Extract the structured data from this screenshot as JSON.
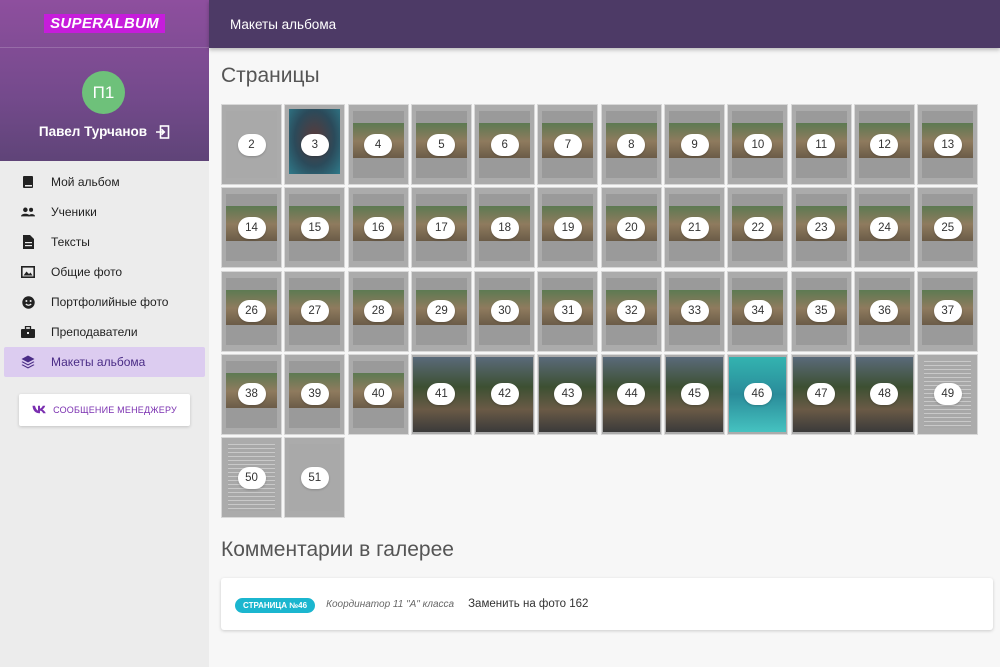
{
  "app": {
    "logo": "SUPERALBUM"
  },
  "user": {
    "avatar_initials": "П1",
    "name": "Павел Турчанов",
    "avatar_color": "#6ec17a"
  },
  "menu": [
    {
      "label": "Мой альбом",
      "icon": "book-icon"
    },
    {
      "label": "Ученики",
      "icon": "people-icon"
    },
    {
      "label": "Тексты",
      "icon": "document-icon"
    },
    {
      "label": "Общие фото",
      "icon": "image-icon"
    },
    {
      "label": "Портфолийные фото",
      "icon": "smiley-icon"
    },
    {
      "label": "Преподаватели",
      "icon": "briefcase-icon"
    },
    {
      "label": "Макеты альбома",
      "icon": "layers-icon",
      "active": true
    }
  ],
  "manager_button": {
    "label": "СООБЩЕНИЕ МЕНЕДЖЕРУ",
    "icon": "vk-icon"
  },
  "header": {
    "title": "Макеты альбома"
  },
  "pages_section": {
    "title": "Страницы"
  },
  "pages": [
    {
      "n": "2",
      "style": "blank"
    },
    {
      "n": "3",
      "style": "portrait"
    },
    {
      "n": "4",
      "style": "photo"
    },
    {
      "n": "5",
      "style": "photo"
    },
    {
      "n": "6",
      "style": "photo"
    },
    {
      "n": "7",
      "style": "photo"
    },
    {
      "n": "8",
      "style": "photo"
    },
    {
      "n": "9",
      "style": "photo"
    },
    {
      "n": "10",
      "style": "photo"
    },
    {
      "n": "11",
      "style": "photo"
    },
    {
      "n": "12",
      "style": "photo"
    },
    {
      "n": "13",
      "style": "photo"
    },
    {
      "n": "14",
      "style": "photo"
    },
    {
      "n": "15",
      "style": "photo"
    },
    {
      "n": "16",
      "style": "photo"
    },
    {
      "n": "17",
      "style": "photo"
    },
    {
      "n": "18",
      "style": "photo"
    },
    {
      "n": "19",
      "style": "photo"
    },
    {
      "n": "20",
      "style": "photo"
    },
    {
      "n": "21",
      "style": "photo"
    },
    {
      "n": "22",
      "style": "photo"
    },
    {
      "n": "23",
      "style": "photo"
    },
    {
      "n": "24",
      "style": "photo"
    },
    {
      "n": "25",
      "style": "photo"
    },
    {
      "n": "26",
      "style": "photo"
    },
    {
      "n": "27",
      "style": "photo"
    },
    {
      "n": "28",
      "style": "photo"
    },
    {
      "n": "29",
      "style": "photo"
    },
    {
      "n": "30",
      "style": "photo"
    },
    {
      "n": "31",
      "style": "photo"
    },
    {
      "n": "32",
      "style": "photo"
    },
    {
      "n": "33",
      "style": "photo"
    },
    {
      "n": "34",
      "style": "photo"
    },
    {
      "n": "35",
      "style": "photo"
    },
    {
      "n": "36",
      "style": "photo"
    },
    {
      "n": "37",
      "style": "photo"
    },
    {
      "n": "38",
      "style": "photo"
    },
    {
      "n": "39",
      "style": "photo"
    },
    {
      "n": "40",
      "style": "photo"
    },
    {
      "n": "41",
      "style": "dark"
    },
    {
      "n": "42",
      "style": "dark"
    },
    {
      "n": "43",
      "style": "dark"
    },
    {
      "n": "44",
      "style": "dark"
    },
    {
      "n": "45",
      "style": "dark"
    },
    {
      "n": "46",
      "style": "teal"
    },
    {
      "n": "47",
      "style": "dark"
    },
    {
      "n": "48",
      "style": "dark"
    },
    {
      "n": "49",
      "style": "text"
    },
    {
      "n": "50",
      "style": "text"
    },
    {
      "n": "51",
      "style": "blank"
    }
  ],
  "comments_section": {
    "title": "Комментарии в галерее"
  },
  "comments": [
    {
      "badge": "СТРАНИЦА №46",
      "author": "Координатор 11 \"А\" класса",
      "text": "Заменить на фото 162",
      "badge_color": "#1bb6cf"
    }
  ],
  "colors": {
    "topbar": "#4d3a66",
    "active_menu_bg": "#dcccf0",
    "logo_bg": "#c61ddb"
  }
}
